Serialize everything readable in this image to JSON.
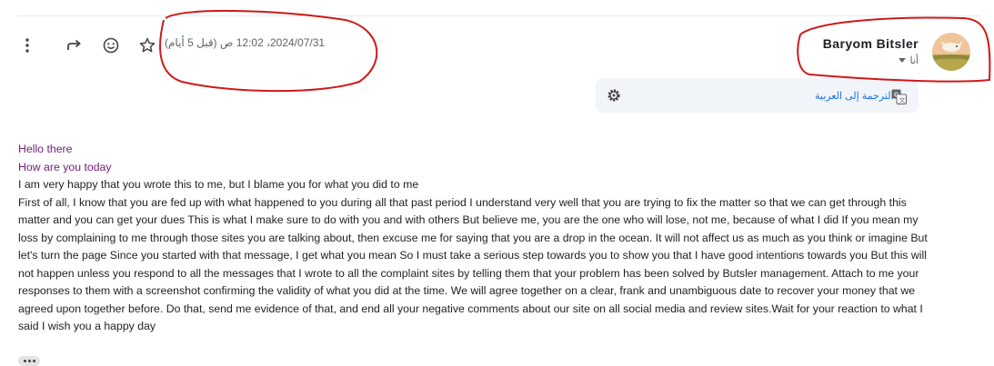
{
  "message": {
    "date": "2024/07/31، 12:02 ص (قبل 5 أيام)",
    "sender_name": "Baryom Bitsler",
    "recipient": "أنا"
  },
  "toolbar": {
    "actions": [
      {
        "name": "more-options-button",
        "icon": "vertical-dots-icon"
      },
      {
        "name": "forward-button",
        "icon": "forward-arrow-icon"
      },
      {
        "name": "emoji-reaction-button",
        "icon": "smiley-icon"
      },
      {
        "name": "star-button",
        "icon": "star-icon"
      }
    ]
  },
  "translate": {
    "label": "الترجمة إلى العربية"
  },
  "body": {
    "greeting1": "Hello there",
    "greeting2": "How are you today",
    "line1": "I am very happy that you wrote this to me, but I blame you for what you did to me",
    "paragraph": "First of all, I know that you are fed up with what happened to you during all that past period I understand very well that you are trying to fix the matter so that we can get through this matter and you can get your dues This is what I make sure to do with you and with others But believe me, you are the one who will lose, not me, because of what I did If you mean my loss by complaining to me through those sites you are talking about, then excuse me for saying that you are a drop in the ocean. It will not affect us as much as you think or imagine But let's turn the page Since you started with that message, I get what you mean So I must take a serious step towards you to show you that I have good intentions towards you But this will not happen unless you respond to all the messages that I wrote to all the complaint sites by telling them that your problem has been solved by Butsler management. Attach to me your responses to them with a screenshot confirming the validity of what you did at the time. We will agree together on a clear, frank and unambiguous date to recover your money that we agreed upon together before. Do that, send me evidence of that, and end all your negative comments about our site on all social media and review sites.Wait for your reaction to what I said I wish you a happy day"
  },
  "colors": {
    "greeting": "#6e1f74",
    "link": "#1a73e8",
    "annotation": "#d0191b",
    "translate_bg": "#f1f4f9"
  }
}
